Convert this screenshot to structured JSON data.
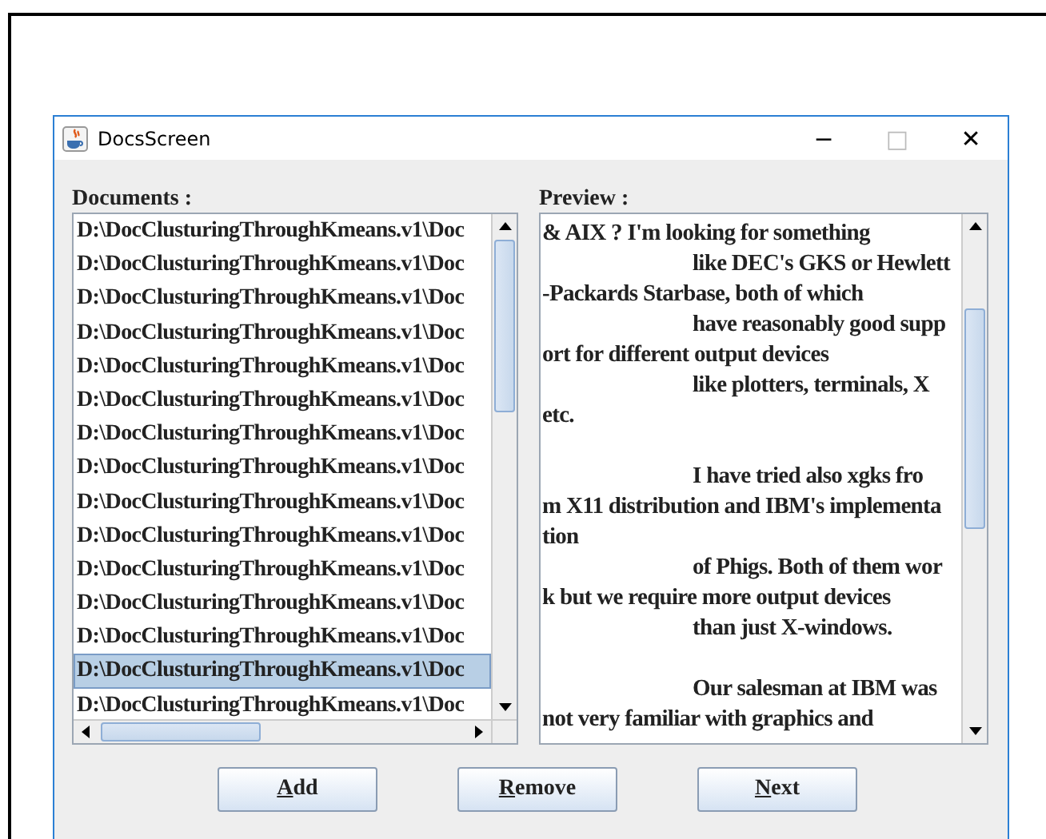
{
  "window": {
    "title": "DocsScreen",
    "controls": [
      "−",
      "□",
      "✕"
    ]
  },
  "documents": {
    "label": "Documents :",
    "items": [
      {
        "text": "D:\\DocClusturingThroughKmeans.v1\\Doc",
        "selected": false
      },
      {
        "text": "D:\\DocClusturingThroughKmeans.v1\\Doc",
        "selected": false
      },
      {
        "text": "D:\\DocClusturingThroughKmeans.v1\\Doc",
        "selected": false
      },
      {
        "text": "D:\\DocClusturingThroughKmeans.v1\\Doc",
        "selected": false
      },
      {
        "text": "D:\\DocClusturingThroughKmeans.v1\\Doc",
        "selected": false
      },
      {
        "text": "D:\\DocClusturingThroughKmeans.v1\\Doc",
        "selected": false
      },
      {
        "text": "D:\\DocClusturingThroughKmeans.v1\\Doc",
        "selected": false
      },
      {
        "text": "D:\\DocClusturingThroughKmeans.v1\\Doc",
        "selected": false
      },
      {
        "text": "D:\\DocClusturingThroughKmeans.v1\\Doc",
        "selected": false
      },
      {
        "text": "D:\\DocClusturingThroughKmeans.v1\\Doc",
        "selected": false
      },
      {
        "text": "D:\\DocClusturingThroughKmeans.v1\\Doc",
        "selected": false
      },
      {
        "text": "D:\\DocClusturingThroughKmeans.v1\\Doc",
        "selected": false
      },
      {
        "text": "D:\\DocClusturingThroughKmeans.v1\\Doc",
        "selected": false
      },
      {
        "text": "D:\\DocClusturingThroughKmeans.v1\\Doc",
        "selected": true
      },
      {
        "text": "D:\\DocClusturingThroughKmeans.v1\\Doc",
        "selected": false
      }
    ]
  },
  "preview": {
    "label": "Preview :",
    "paragraphs": [
      {
        "lines": [
          {
            "text": "& AIX ? I'm looking for something",
            "kind": "plain"
          },
          {
            "text": "like DEC's GKS or Hewlett",
            "kind": "indented"
          },
          {
            "text": "-Packards Starbase, both of which",
            "kind": "plain"
          },
          {
            "text": "have reasonably good supp",
            "kind": "indented"
          },
          {
            "text": "ort for different output devices",
            "kind": "plain"
          },
          {
            "text": "like plotters, terminals, X",
            "kind": "indented"
          },
          {
            "text": "etc.",
            "kind": "plain"
          }
        ]
      },
      {
        "lines": [
          {
            "text": "I have tried also xgks fro",
            "kind": "indented"
          },
          {
            "text": "m X11 distribution and IBM's implementa",
            "kind": "plain"
          },
          {
            "text": "tion",
            "kind": "plain"
          },
          {
            "text": "of Phigs. Both of them wor",
            "kind": "indented"
          },
          {
            "text": "k but we require more output devices",
            "kind": "plain"
          },
          {
            "text": "than just X-windows.",
            "kind": "indented"
          }
        ]
      },
      {
        "lines": [
          {
            "text": "Our salesman at IBM was",
            "kind": "indented"
          },
          {
            "text": "not very familiar with graphics and",
            "kind": "plain"
          }
        ]
      }
    ]
  },
  "buttons": [
    "Add",
    "Remove",
    "Next"
  ]
}
